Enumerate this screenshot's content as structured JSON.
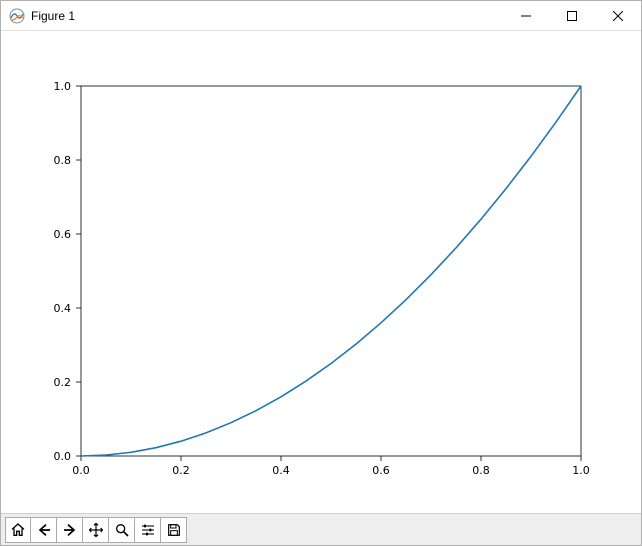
{
  "window": {
    "title": "Figure 1"
  },
  "toolbar": {
    "home": "Home",
    "back": "Back",
    "forward": "Forward",
    "pan": "Pan",
    "zoom": "Zoom",
    "configure": "Configure subplots",
    "save": "Save the figure"
  },
  "chart_data": {
    "type": "line",
    "x": [
      0.0,
      0.05,
      0.1,
      0.15,
      0.2,
      0.25,
      0.3,
      0.35,
      0.4,
      0.45,
      0.5,
      0.55,
      0.6,
      0.65,
      0.7,
      0.75,
      0.8,
      0.85,
      0.9,
      0.95,
      1.0
    ],
    "y": [
      0.0,
      0.0025,
      0.01,
      0.0225,
      0.04,
      0.0625,
      0.09,
      0.1225,
      0.16,
      0.2025,
      0.25,
      0.3025,
      0.36,
      0.4225,
      0.49,
      0.5625,
      0.64,
      0.7225,
      0.81,
      0.9025,
      1.0
    ],
    "title": "",
    "xlabel": "",
    "ylabel": "",
    "xlim": [
      0.0,
      1.0
    ],
    "ylim": [
      0.0,
      1.0
    ],
    "xticks": [
      0.0,
      0.2,
      0.4,
      0.6,
      0.8,
      1.0
    ],
    "yticks": [
      0.0,
      0.2,
      0.4,
      0.6,
      0.8,
      1.0
    ],
    "xtick_labels": [
      "0.0",
      "0.2",
      "0.4",
      "0.6",
      "0.8",
      "1.0"
    ],
    "ytick_labels": [
      "0.0",
      "0.2",
      "0.4",
      "0.6",
      "0.8",
      "1.0"
    ],
    "line_color": "#1f77b4"
  }
}
